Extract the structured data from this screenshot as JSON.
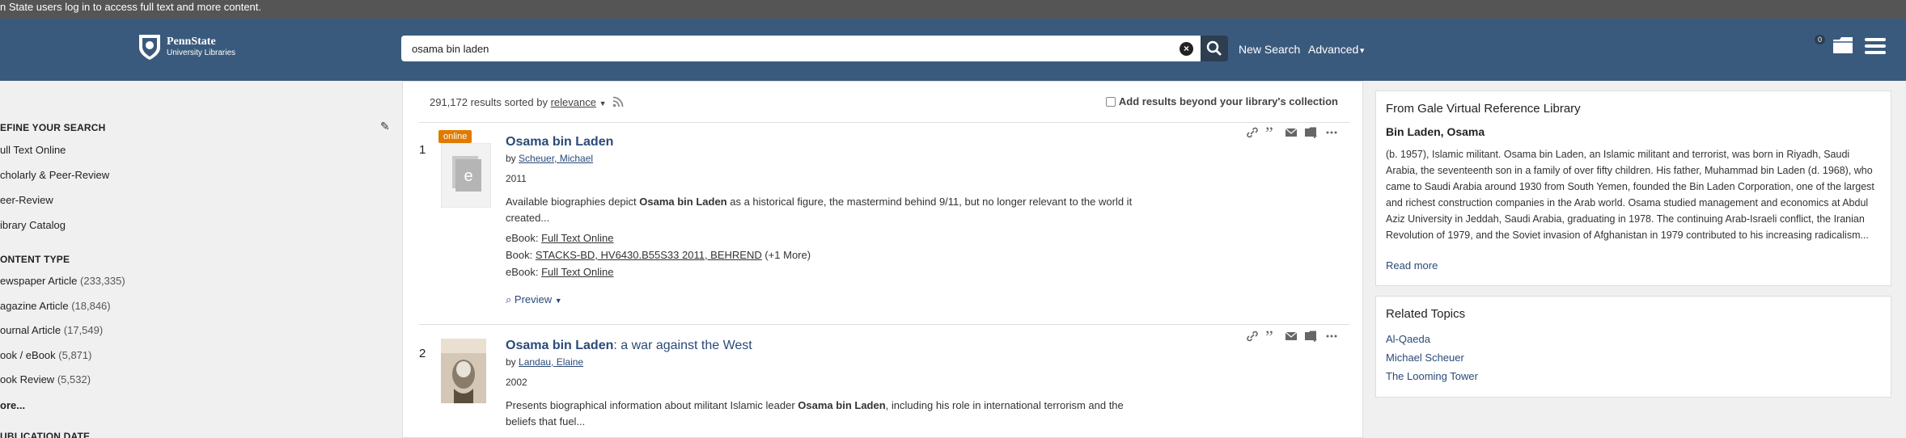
{
  "notice": "n State users log in to access full text and more content.",
  "header": {
    "logo_line1": "PennState",
    "logo_line2": "University Libraries",
    "search_value": "osama bin laden",
    "new_search": "New Search",
    "advanced": "Advanced",
    "folder_count": "0"
  },
  "sidebar": {
    "refine_heading": "EFINE YOUR SEARCH",
    "refine_items": [
      "ull Text Online",
      "cholarly & Peer-Review",
      "eer-Review",
      "ibrary Catalog"
    ],
    "content_heading": "ONTENT TYPE",
    "content_items": [
      {
        "label": "ewspaper Article",
        "count": "(233,335)"
      },
      {
        "label": "agazine Article",
        "count": "(18,846)"
      },
      {
        "label": "ournal Article",
        "count": "(17,549)"
      },
      {
        "label": "ook / eBook",
        "count": "(5,871)"
      },
      {
        "label": "ook Review",
        "count": "(5,532)"
      }
    ],
    "more": "ore...",
    "pub_heading": "UBLICATION DATE"
  },
  "results": {
    "summary_prefix": "291,172 results sorted by ",
    "sort": "relevance",
    "beyond_label": "Add results beyond your library's collection",
    "items": [
      {
        "num": "1",
        "tag": "online",
        "title": "Osama bin Laden",
        "subtitle": "",
        "by": "by ",
        "author": "Scheuer, Michael",
        "year": "2011",
        "desc_pre": "Available biographies depict ",
        "desc_bold": "Osama bin Laden",
        "desc_post": " as a historical figure, the mastermind behind 9/11, but no longer relevant to the world it created...",
        "line1_label": "eBook: ",
        "line1_link": "Full Text Online",
        "line2_label": "Book: ",
        "line2_link": "STACKS-BD, HV6430.B55S33 2011, BEHREND",
        "line2_extra": " (+1 More)",
        "line3_label": "eBook: ",
        "line3_link": "Full Text Online",
        "preview": "Preview"
      },
      {
        "num": "2",
        "title": "Osama bin Laden",
        "subtitle": ": a war against the West",
        "by": "by ",
        "author": "Landau, Elaine",
        "year": "2002",
        "desc_pre": "Presents biographical information about militant Islamic leader ",
        "desc_bold": "Osama bin Laden",
        "desc_post": ", including his role in international terrorism and the beliefs that fuel..."
      }
    ]
  },
  "gale": {
    "heading": "From Gale Virtual Reference Library",
    "name": "Bin Laden, Osama",
    "text": "(b. 1957), Islamic militant. Osama bin Laden, an Islamic militant and terrorist, was born in Riyadh, Saudi Arabia, the seventeenth son in a family of over fifty children. His father, Muhammad bin Laden (d. 1968), who came to Saudi Arabia around 1930 from South Yemen, founded the Bin Laden Corporation, one of the largest and richest construction companies in the Arab world. Osama studied management and economics at Abdul Aziz University in Jeddah, Saudi Arabia, graduating in 1978. The continuing Arab-Israeli conflict, the Iranian Revolution of 1979, and the Soviet invasion of Afghanistan in 1979 contributed to his increasing radicalism...",
    "read_more": "Read more"
  },
  "related": {
    "heading": "Related Topics",
    "topics": [
      "Al-Qaeda",
      "Michael Scheuer",
      "The Looming Tower"
    ]
  },
  "colors": {
    "header": "#3a5a7d",
    "link": "#2a4a78",
    "online_tag": "#e07b00"
  }
}
